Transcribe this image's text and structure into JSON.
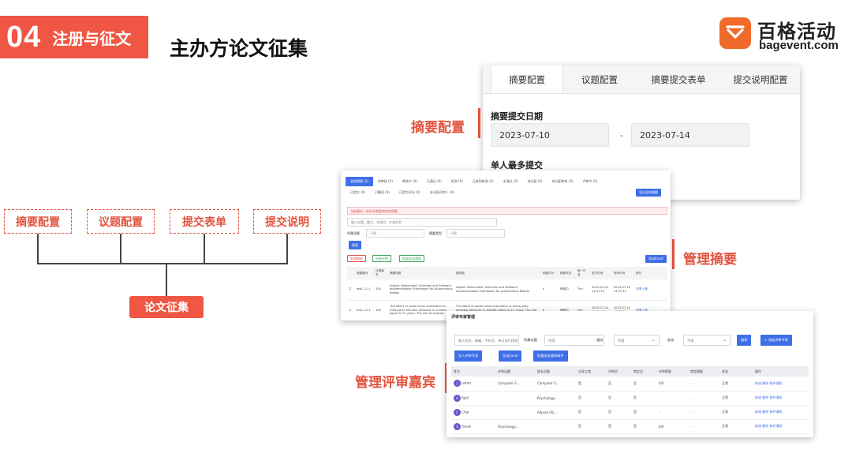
{
  "header": {
    "section_number": "04",
    "section_label": "注册与征文",
    "title": "主办方论文征集"
  },
  "logo": {
    "cn": "百格活动",
    "en": "bagevent.com",
    "color": "#f06a2b"
  },
  "diagram": {
    "items": [
      "摘要配置",
      "议题配置",
      "提交表单",
      "提交说明"
    ],
    "root": "论文征集"
  },
  "callouts": {
    "abstract_config": "摘要配置",
    "manage_abstracts": "管理摘要",
    "manage_reviewers": "管理评审嘉宾"
  },
  "abstract_config_card": {
    "tabs": [
      "摘要配置",
      "议题配置",
      "摘要提交表单",
      "提交说明配置"
    ],
    "submit_date_label": "摘要提交日期",
    "start_date": "2023-07-10",
    "separator": "-",
    "end_date": "2023-07-14",
    "max_label": "单人最多提交"
  },
  "manage_card": {
    "tabs_row1": [
      "全部摘要 (2)",
      "待审核 (0)",
      "审核中 (0)",
      "已通过 (0)",
      "拒绝 (0)",
      "已收到修改 (0)",
      "未通过 (0)",
      "待分配 (0)",
      "待分配审核 (0)",
      "评审中 (0)"
    ],
    "tabs_row2": [
      "已提交 (0)",
      "已撤回 (0)",
      "已提交评分 (0)",
      "未分配评审人 (0)"
    ],
    "export_button": "导出全部摘要",
    "alert": "当前最近一轮仍有需要审核的摘要",
    "search_placeholder": "输入标题、题目、关键词、作者检索",
    "filter1_label": "所属议题",
    "filter1_value": "不限",
    "filter2_label": "摘要类型",
    "filter2_value": "不限",
    "search_button": "搜索",
    "action_batch": "批量删除",
    "action_assign": "分配评审",
    "action_notify": "批量发送通知",
    "export_excel": "导出Excel",
    "columns": [
      "",
      "摘要编号",
      "议题编号",
      "摘要标题",
      "副标题",
      "摘要评分",
      "摘要状态",
      "第一作者",
      "提交时间",
      "修改时间",
      "操作"
    ],
    "rows": [
      {
        "code": "test-1-1-1",
        "topic": "100",
        "title": "Adjoint Observation Schemes and Software Implementation Framework for Autonomous Robots",
        "subtitle": "Adjoint Observation Schemes and Software Implementation Framework for Autonomous Robots",
        "score": "0",
        "status": "审核中",
        "author": "Tim",
        "submitted": "2023-07-10 14:47:12",
        "modified": "2023-07-10 14:47:12",
        "ops": "详情 分配"
      },
      {
        "code": "test-1-2-1",
        "topic": "100",
        "title": "The effect of social value orientation on third-party altruistic behavior in children aged 10-12 years: The role of emotion",
        "subtitle": "The effect of social value orientation on third-party altruistic behavior in children aged 10-12 years: The role of emotion",
        "score": "0",
        "status": "审核中",
        "author": "Tim",
        "submitted": "2023-07-10 15:10:43",
        "modified": "2023-07-10 15:26:19",
        "ops": "详情 分配"
      }
    ]
  },
  "reviewer_card": {
    "title": "评审专家管理",
    "search_placeholder": "输入姓名、邮箱、手机号、单位进行搜索",
    "filter_topic_label": "所属议题",
    "filter_topic_value": "不限",
    "filter_group_label": "组别",
    "filter_group_value": "不限",
    "filter_status_label": "状态",
    "filter_status_value": "不限",
    "search_button": "搜索",
    "add_button": "+ 添加评审专家",
    "import_button": "导入评审专家",
    "export_button": "导出Excel",
    "notify_button": "批量发送通知邮件",
    "columns": [
      "姓名",
      "评审议题",
      "擅长议题",
      "分享主席",
      "评审员",
      "审定员",
      "评审摘要",
      "审定摘要",
      "状态",
      "操作"
    ],
    "rows": [
      {
        "avatar": "J",
        "name": "James",
        "topic": "Computer S...",
        "expert": "Computer S...",
        "chair": "是",
        "reviewer": "否",
        "approver": "否",
        "reviewed": "0/0",
        "approved": "-",
        "status": "正常",
        "ops": [
          "修改",
          "删除",
          "邮件通知"
        ]
      },
      {
        "avatar": "A",
        "name": "April",
        "topic": "",
        "expert": "Psychology...",
        "chair": "否",
        "reviewer": "否",
        "approver": "否",
        "reviewed": "-",
        "approved": "-",
        "status": "正常",
        "ops": [
          "修改",
          "删除",
          "邮件通知"
        ]
      },
      {
        "avatar": "C",
        "name": "Char",
        "topic": "",
        "expert": "Adjoint Ob...",
        "chair": "否",
        "reviewer": "否",
        "approver": "否",
        "reviewed": "-",
        "approved": "-",
        "status": "正常",
        "ops": [
          "修改",
          "删除",
          "邮件通知"
        ]
      },
      {
        "avatar": "S",
        "name": "Susan",
        "topic": "Psychology...",
        "expert": "",
        "chair": "否",
        "reviewer": "是",
        "approver": "否",
        "reviewed": "0/0",
        "approved": "-",
        "status": "正常",
        "ops": [
          "修改",
          "删除",
          "邮件通知"
        ]
      }
    ]
  },
  "colors": {
    "accent": "#ef5643",
    "primary_blue": "#3e6ee8"
  }
}
